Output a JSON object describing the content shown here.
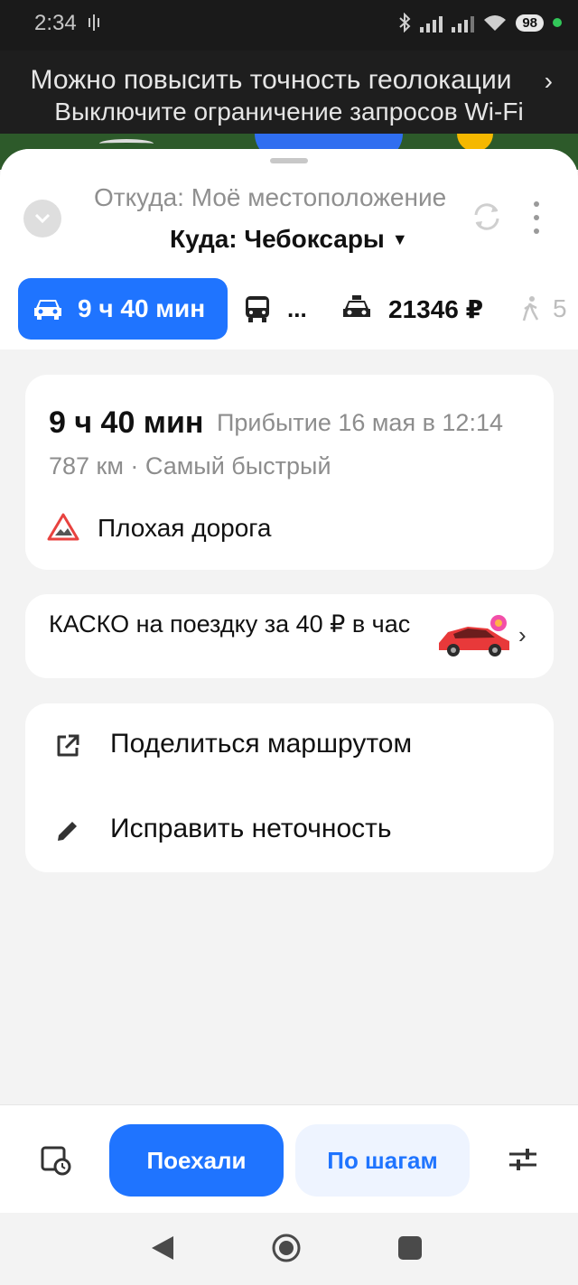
{
  "status_bar": {
    "time": "2:34",
    "battery": "98"
  },
  "banner": {
    "line1": "Можно повысить точность геолокации",
    "line2": "Выключите ограничение запросов Wi-Fi",
    "chevron": "›"
  },
  "route_header": {
    "from": "Откуда: Моё местоположение",
    "to": "Куда: Чебоксары",
    "to_dropdown": "▼"
  },
  "transport_tabs": [
    {
      "icon": "car-icon",
      "label": "9 ч 40 мин",
      "selected": true
    },
    {
      "icon": "bus-icon",
      "label": "..."
    },
    {
      "icon": "taxi-icon",
      "label": "21346 ₽"
    },
    {
      "icon": "walk-icon",
      "label": "5"
    }
  ],
  "route_card": {
    "duration": "9 ч 40 мин",
    "arrival": "Прибытие 16 мая в 12:14",
    "distance": "787 км · Самый быстрый",
    "warning": "Плохая дорога"
  },
  "kasko": {
    "text": "КАСКО на поездку за 40 ₽ в час",
    "chevron": "›"
  },
  "actions": [
    {
      "icon": "share-icon",
      "label": "Поделиться маршрутом"
    },
    {
      "icon": "pencil-icon",
      "label": "Исправить неточность"
    }
  ],
  "bottom_bar": {
    "go_label": "Поехали",
    "steps_label": "По шагам"
  },
  "colors": {
    "accent": "#1f74ff",
    "warning": "#e8423f",
    "background": "#f3f3f3"
  }
}
